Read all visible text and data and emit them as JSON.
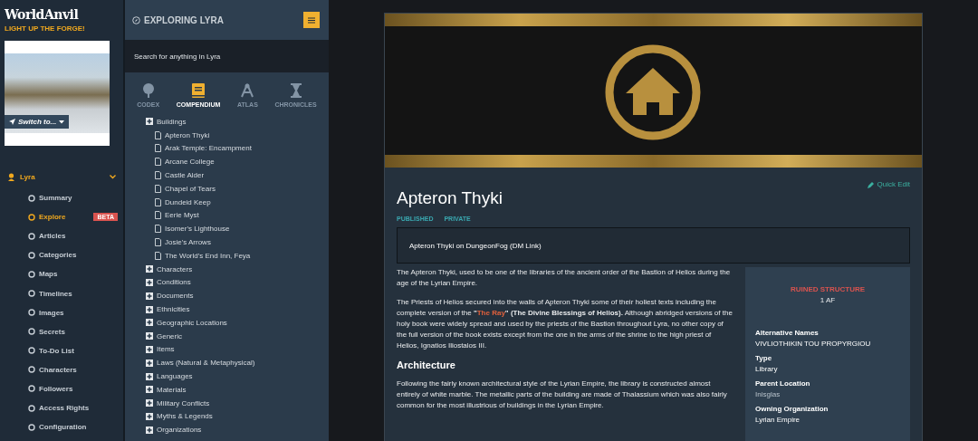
{
  "brand": {
    "logo": "WorldAnvil",
    "tagline": "LIGHT UP THE FORGE!",
    "switch_button": "Switch to..."
  },
  "world_menu": {
    "label": "Lyra",
    "expanded": true,
    "items": [
      {
        "label": "Summary",
        "selected": false
      },
      {
        "label": "Explore",
        "selected": true,
        "badge": "BETA"
      },
      {
        "label": "Articles",
        "selected": false
      },
      {
        "label": "Categories",
        "selected": false
      },
      {
        "label": "Maps",
        "selected": false
      },
      {
        "label": "Timelines",
        "selected": false
      },
      {
        "label": "Images",
        "selected": false
      },
      {
        "label": "Secrets",
        "selected": false
      },
      {
        "label": "To-Do List",
        "selected": false
      },
      {
        "label": "Characters",
        "selected": false
      },
      {
        "label": "Followers",
        "selected": false
      },
      {
        "label": "Access Rights",
        "selected": false
      },
      {
        "label": "Configuration",
        "selected": false
      }
    ]
  },
  "explorer": {
    "title": "EXPLORING LYRA",
    "search": {
      "placeholder": "Search for anything in Lyra"
    },
    "tabs": [
      {
        "label": "CODEX",
        "kind": "tree",
        "selected": false
      },
      {
        "label": "COMPENDIUM",
        "kind": "book",
        "selected": true
      },
      {
        "label": "ATLAS",
        "kind": "compass",
        "selected": false
      },
      {
        "label": "CHRONICLES",
        "kind": "hourglass",
        "selected": false
      }
    ],
    "tree": [
      {
        "label": "Buildings",
        "children": [
          {
            "label": "Apteron Thyki"
          },
          {
            "label": "Arak Temple: Encampment"
          },
          {
            "label": "Arcane College"
          },
          {
            "label": "Castle Alder"
          },
          {
            "label": "Chapel of Tears"
          },
          {
            "label": "Dundeid Keep"
          },
          {
            "label": "Eerie Myst"
          },
          {
            "label": "Isomer's Lighthouse"
          },
          {
            "label": "Josie's Arrows"
          },
          {
            "label": "The World's End Inn, Feya"
          }
        ]
      },
      {
        "label": "Characters"
      },
      {
        "label": "Conditions"
      },
      {
        "label": "Documents"
      },
      {
        "label": "Ethnicities"
      },
      {
        "label": "Geographic Locations"
      },
      {
        "label": "Generic"
      },
      {
        "label": "Items"
      },
      {
        "label": "Laws (Natural & Metaphysical)"
      },
      {
        "label": "Languages"
      },
      {
        "label": "Materials"
      },
      {
        "label": "Military Conflicts"
      },
      {
        "label": "Myths & Legends"
      },
      {
        "label": "Organizations"
      }
    ]
  },
  "article": {
    "quick_edit": "Quick Edit",
    "title": "Apteron Thyki",
    "tags": [
      "PUBLISHED",
      "PRIVATE"
    ],
    "link_box": "Apteron Thyki on DungeonFog (DM Link)",
    "paragraphs": [
      {
        "kind": "text",
        "before": "The Apteron Thyki, used to be one of the libraries of the ancient order of the Bastion of Helios during the age of the Lyrian Empire."
      },
      {
        "kind": "text",
        "before": "The Priests of Helios secured into the walls of Apteron Thyki some of their holiest texts including the complete version of the **\"**",
        "link": "The Ray",
        "after": "**\" (The Divine Blessings of Helios).** Although abridged versions of the holy book were widely spread and used by the priests of the Bastion throughout Lyra, no other copy of the full version of the book exists except from the one in the arms of the shrine to the high priest of Helios, Ignatios Iliostalos III."
      },
      {
        "kind": "heading",
        "before": "Architecture"
      },
      {
        "kind": "text",
        "before": "Following the fairly known architectural style of the Lyrian Empire, the library is constructed almost entirely of white marble. The metallic parts of the building are made of Thalassium which was also fairly common for the most illustrious of buildings in the Lyrian Empire."
      }
    ],
    "infobox": {
      "type": "RUINED STRUCTURE",
      "date": "1 AF",
      "fields": [
        {
          "label": "Alternative Names",
          "value": "VIVLIOTHIKIN TOU PROPYRGIOU",
          "kind": "text"
        },
        {
          "label": "Type",
          "value": "Library",
          "kind": "text"
        },
        {
          "label": "Parent Location",
          "value": "Inisglas",
          "kind": "link"
        },
        {
          "label": "Owning Organization",
          "value": "Lyrian Empire",
          "kind": "text"
        }
      ]
    }
  }
}
